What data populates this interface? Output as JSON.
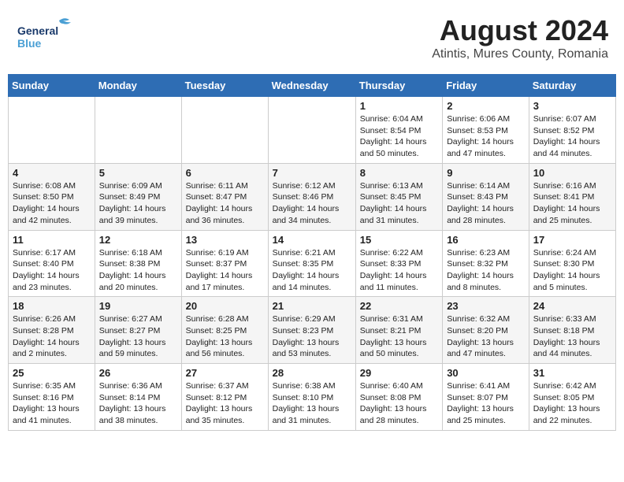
{
  "header": {
    "logo_line1": "General",
    "logo_line2": "Blue",
    "month_year": "August 2024",
    "location": "Atintis, Mures County, Romania"
  },
  "days_of_week": [
    "Sunday",
    "Monday",
    "Tuesday",
    "Wednesday",
    "Thursday",
    "Friday",
    "Saturday"
  ],
  "weeks": [
    [
      {
        "num": "",
        "info": ""
      },
      {
        "num": "",
        "info": ""
      },
      {
        "num": "",
        "info": ""
      },
      {
        "num": "",
        "info": ""
      },
      {
        "num": "1",
        "info": "Sunrise: 6:04 AM\nSunset: 8:54 PM\nDaylight: 14 hours and 50 minutes."
      },
      {
        "num": "2",
        "info": "Sunrise: 6:06 AM\nSunset: 8:53 PM\nDaylight: 14 hours and 47 minutes."
      },
      {
        "num": "3",
        "info": "Sunrise: 6:07 AM\nSunset: 8:52 PM\nDaylight: 14 hours and 44 minutes."
      }
    ],
    [
      {
        "num": "4",
        "info": "Sunrise: 6:08 AM\nSunset: 8:50 PM\nDaylight: 14 hours and 42 minutes."
      },
      {
        "num": "5",
        "info": "Sunrise: 6:09 AM\nSunset: 8:49 PM\nDaylight: 14 hours and 39 minutes."
      },
      {
        "num": "6",
        "info": "Sunrise: 6:11 AM\nSunset: 8:47 PM\nDaylight: 14 hours and 36 minutes."
      },
      {
        "num": "7",
        "info": "Sunrise: 6:12 AM\nSunset: 8:46 PM\nDaylight: 14 hours and 34 minutes."
      },
      {
        "num": "8",
        "info": "Sunrise: 6:13 AM\nSunset: 8:45 PM\nDaylight: 14 hours and 31 minutes."
      },
      {
        "num": "9",
        "info": "Sunrise: 6:14 AM\nSunset: 8:43 PM\nDaylight: 14 hours and 28 minutes."
      },
      {
        "num": "10",
        "info": "Sunrise: 6:16 AM\nSunset: 8:41 PM\nDaylight: 14 hours and 25 minutes."
      }
    ],
    [
      {
        "num": "11",
        "info": "Sunrise: 6:17 AM\nSunset: 8:40 PM\nDaylight: 14 hours and 23 minutes."
      },
      {
        "num": "12",
        "info": "Sunrise: 6:18 AM\nSunset: 8:38 PM\nDaylight: 14 hours and 20 minutes."
      },
      {
        "num": "13",
        "info": "Sunrise: 6:19 AM\nSunset: 8:37 PM\nDaylight: 14 hours and 17 minutes."
      },
      {
        "num": "14",
        "info": "Sunrise: 6:21 AM\nSunset: 8:35 PM\nDaylight: 14 hours and 14 minutes."
      },
      {
        "num": "15",
        "info": "Sunrise: 6:22 AM\nSunset: 8:33 PM\nDaylight: 14 hours and 11 minutes."
      },
      {
        "num": "16",
        "info": "Sunrise: 6:23 AM\nSunset: 8:32 PM\nDaylight: 14 hours and 8 minutes."
      },
      {
        "num": "17",
        "info": "Sunrise: 6:24 AM\nSunset: 8:30 PM\nDaylight: 14 hours and 5 minutes."
      }
    ],
    [
      {
        "num": "18",
        "info": "Sunrise: 6:26 AM\nSunset: 8:28 PM\nDaylight: 14 hours and 2 minutes."
      },
      {
        "num": "19",
        "info": "Sunrise: 6:27 AM\nSunset: 8:27 PM\nDaylight: 13 hours and 59 minutes."
      },
      {
        "num": "20",
        "info": "Sunrise: 6:28 AM\nSunset: 8:25 PM\nDaylight: 13 hours and 56 minutes."
      },
      {
        "num": "21",
        "info": "Sunrise: 6:29 AM\nSunset: 8:23 PM\nDaylight: 13 hours and 53 minutes."
      },
      {
        "num": "22",
        "info": "Sunrise: 6:31 AM\nSunset: 8:21 PM\nDaylight: 13 hours and 50 minutes."
      },
      {
        "num": "23",
        "info": "Sunrise: 6:32 AM\nSunset: 8:20 PM\nDaylight: 13 hours and 47 minutes."
      },
      {
        "num": "24",
        "info": "Sunrise: 6:33 AM\nSunset: 8:18 PM\nDaylight: 13 hours and 44 minutes."
      }
    ],
    [
      {
        "num": "25",
        "info": "Sunrise: 6:35 AM\nSunset: 8:16 PM\nDaylight: 13 hours and 41 minutes."
      },
      {
        "num": "26",
        "info": "Sunrise: 6:36 AM\nSunset: 8:14 PM\nDaylight: 13 hours and 38 minutes."
      },
      {
        "num": "27",
        "info": "Sunrise: 6:37 AM\nSunset: 8:12 PM\nDaylight: 13 hours and 35 minutes."
      },
      {
        "num": "28",
        "info": "Sunrise: 6:38 AM\nSunset: 8:10 PM\nDaylight: 13 hours and 31 minutes."
      },
      {
        "num": "29",
        "info": "Sunrise: 6:40 AM\nSunset: 8:08 PM\nDaylight: 13 hours and 28 minutes."
      },
      {
        "num": "30",
        "info": "Sunrise: 6:41 AM\nSunset: 8:07 PM\nDaylight: 13 hours and 25 minutes."
      },
      {
        "num": "31",
        "info": "Sunrise: 6:42 AM\nSunset: 8:05 PM\nDaylight: 13 hours and 22 minutes."
      }
    ]
  ]
}
